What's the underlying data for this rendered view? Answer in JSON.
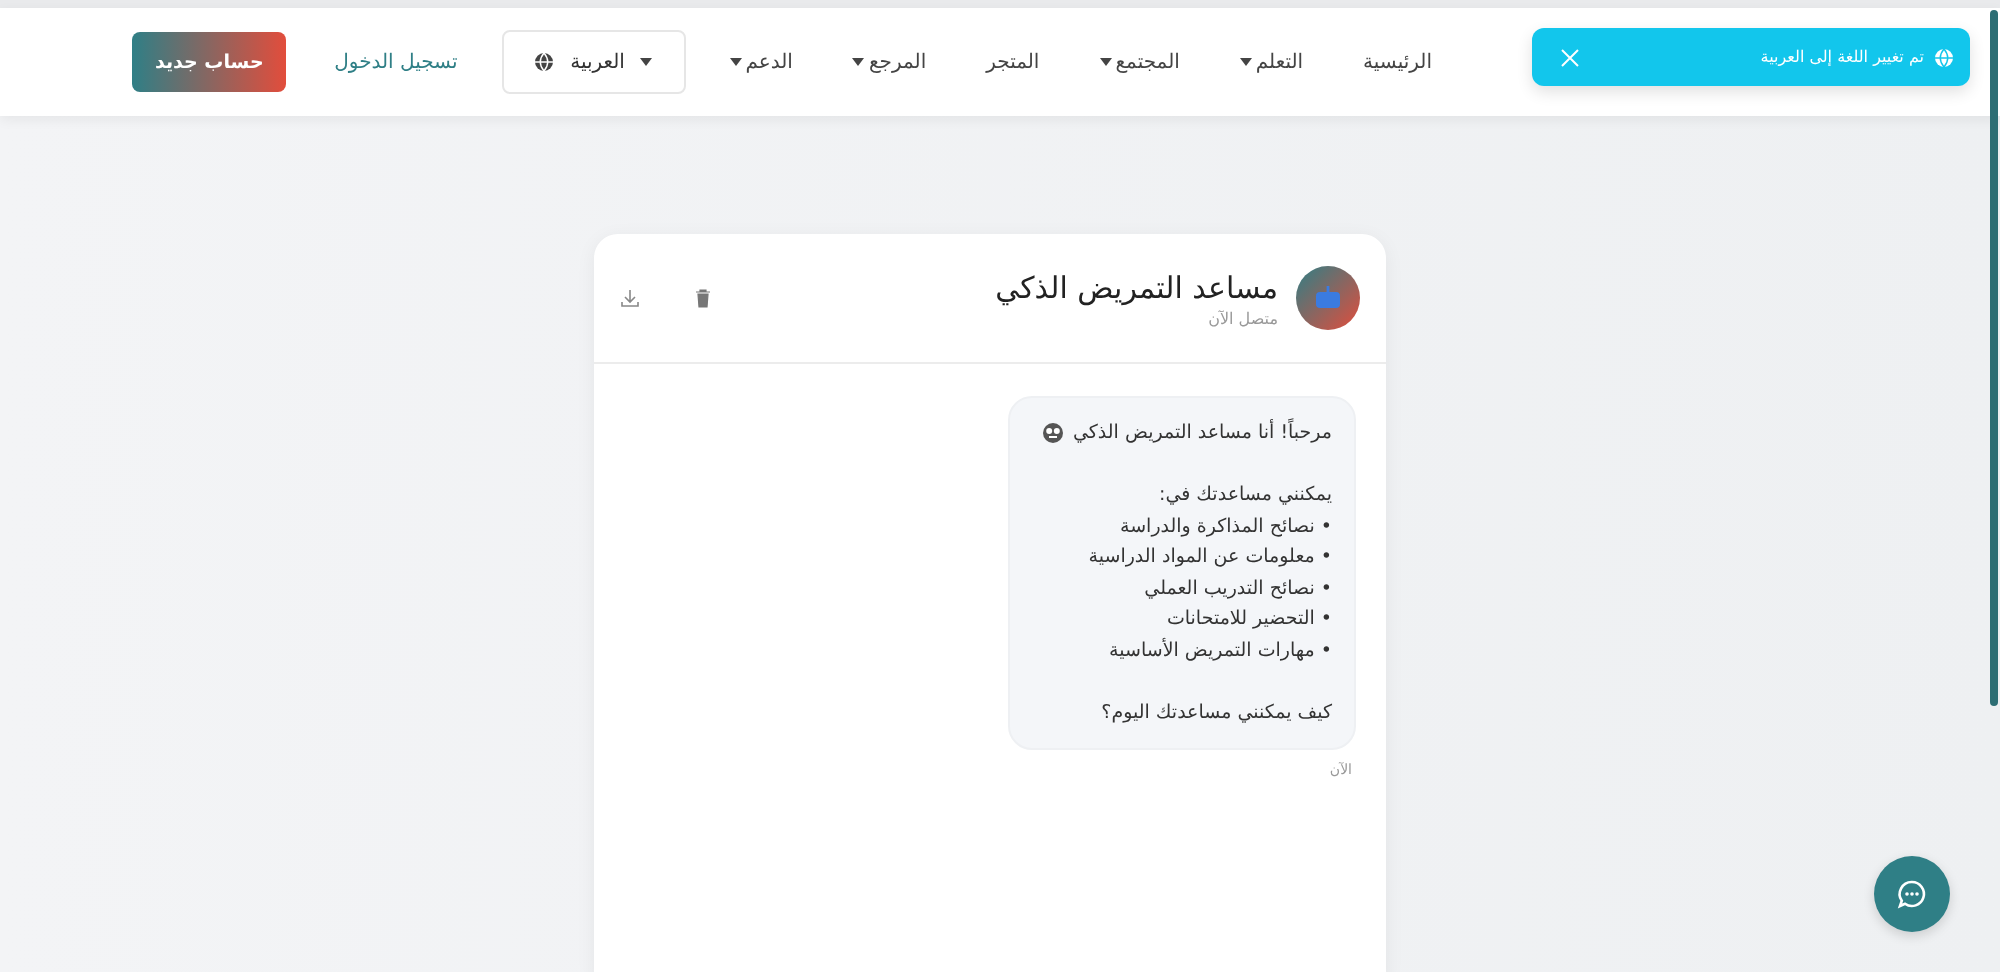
{
  "navbar": {
    "links": [
      {
        "label": "الرئيسية",
        "dropdown": false
      },
      {
        "label": "التعلم",
        "dropdown": true
      },
      {
        "label": "المجتمع",
        "dropdown": true
      },
      {
        "label": "المتجر",
        "dropdown": false
      },
      {
        "label": "المرجع",
        "dropdown": true
      },
      {
        "label": "الدعم",
        "dropdown": true
      }
    ],
    "language": "العربية",
    "login": "تسجيل الدخول",
    "signup": "حساب جديد"
  },
  "toast": {
    "message": "تم تغيير اللغة إلى العربية"
  },
  "chat": {
    "title": "مساعد التمريض الذكي",
    "status": "متصل الآن",
    "messages": [
      {
        "paragraphs": [
          [
            "مرحباً! أنا مساعد التمريض الذكي"
          ],
          [
            "يمكنني مساعدتك في:",
            "• نصائح المذاكرة والدراسة",
            "• معلومات عن المواد الدراسية",
            "• نصائح التدريب العملي",
            "• التحضير للامتحانات",
            "• مهارات التمريض الأساسية"
          ],
          [
            "كيف يمكنني مساعدتك اليوم؟"
          ]
        ],
        "time": "الآن"
      }
    ]
  }
}
